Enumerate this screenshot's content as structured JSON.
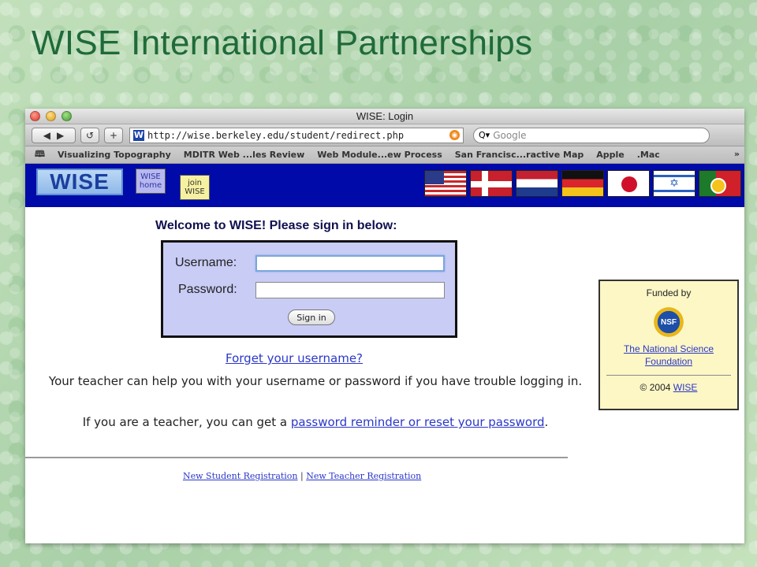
{
  "slide": {
    "title": "WISE International Partnerships"
  },
  "browser": {
    "window_title": "WISE: Login",
    "url": "http://wise.berkeley.edu/student/redirect.php",
    "search_placeholder": "Google",
    "bookmarks": [
      "Visualizing Topography",
      "MDITR Web ...les Review",
      "Web Module...ew Process",
      "San Francisc...ractive Map",
      "Apple",
      ".Mac"
    ],
    "bookmarks_more": "»"
  },
  "site": {
    "logo": "WISE",
    "nav_home": "WISE home",
    "nav_join": "join WISE",
    "flags": [
      "flag-us",
      "flag-norway",
      "flag-netherlands",
      "flag-germany",
      "flag-japan",
      "flag-israel",
      "flag-portugal"
    ]
  },
  "login": {
    "welcome": "Welcome to WISE! Please sign in below:",
    "username_label": "Username:",
    "password_label": "Password:",
    "signin_label": "Sign in",
    "forget_link": "Forget your username?",
    "help_text": "Your teacher can help you with your username or password if you have trouble logging in.",
    "teacher_text_prefix": "If you are a teacher, you can get a ",
    "teacher_link": "password reminder or reset your password",
    "teacher_text_suffix": ".",
    "new_student": "New Student Registration",
    "separator": " | ",
    "new_teacher": "New Teacher Registration"
  },
  "funding": {
    "title": "Funded by",
    "logo_text": "NSF",
    "org_link": "The National Science Foundation",
    "copyright_prefix": "© 2004 ",
    "copyright_link": "WISE"
  }
}
